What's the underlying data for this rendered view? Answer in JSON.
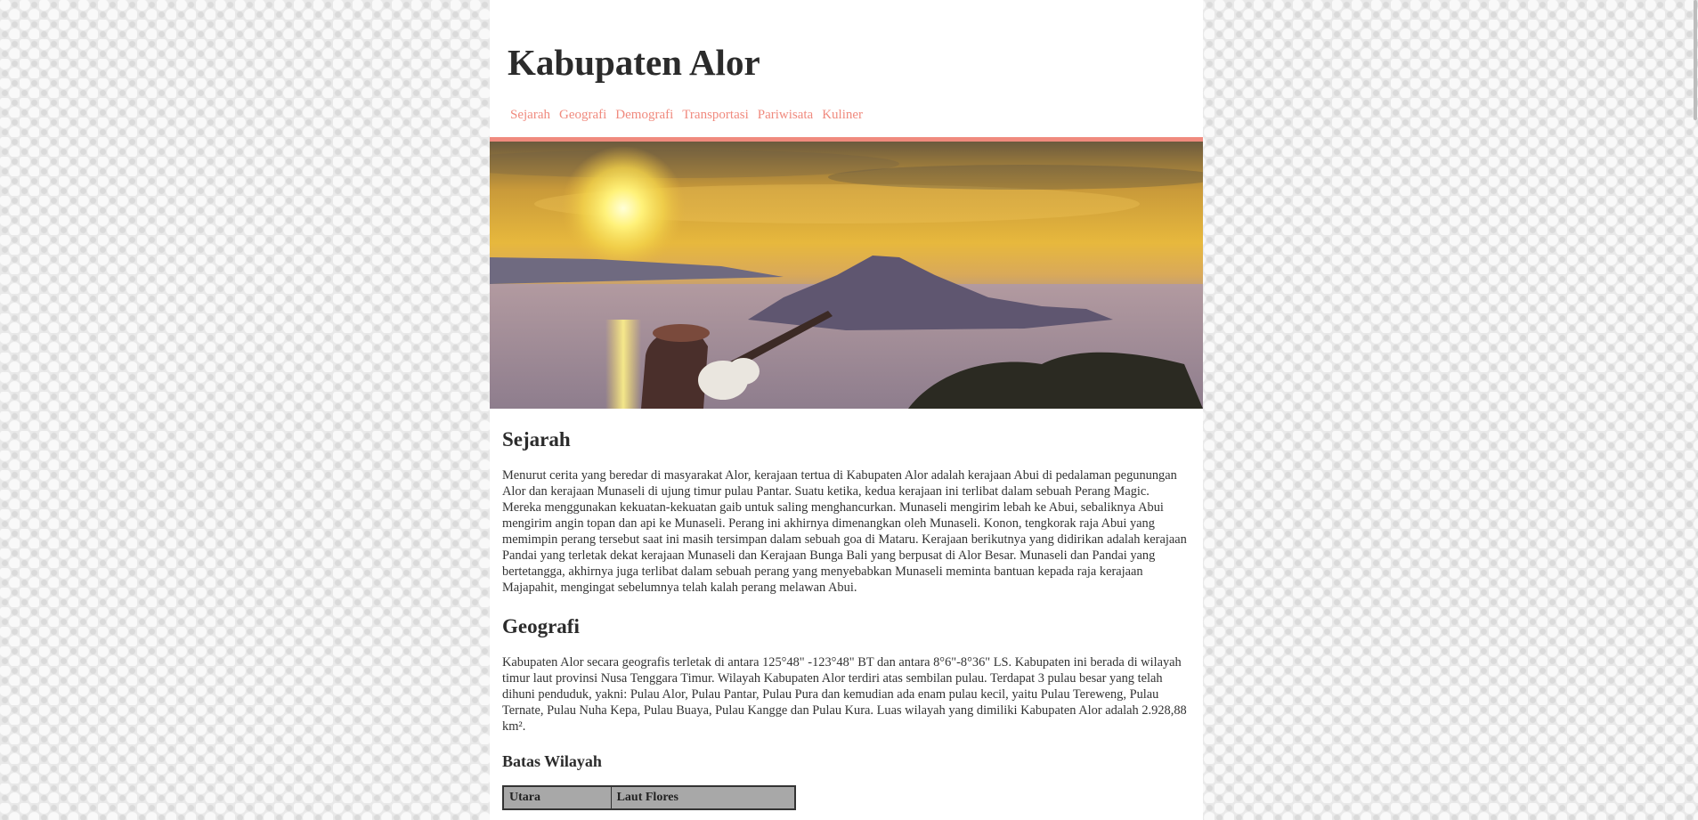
{
  "header": {
    "title": "Kabupaten Alor",
    "nav": [
      "Sejarah",
      "Geografi",
      "Demografi",
      "Transportasi",
      "Pariwisata",
      "Kuliner"
    ]
  },
  "colors": {
    "accent": "#f08a7e",
    "text": "#333333",
    "background": "#ffffff"
  },
  "sections": {
    "sejarah": {
      "heading": "Sejarah",
      "text": "Menurut cerita yang beredar di masyarakat Alor, kerajaan tertua di Kabupaten Alor adalah kerajaan Abui di pedalaman pegunungan Alor dan kerajaan Munaseli di ujung timur pulau Pantar. Suatu ketika, kedua kerajaan ini terlibat dalam sebuah Perang Magic. Mereka menggunakan kekuatan-kekuatan gaib untuk saling menghancurkan. Munaseli mengirim lebah ke Abui, sebaliknya Abui mengirim angin topan dan api ke Munaseli. Perang ini akhirnya dimenangkan oleh Munaseli. Konon, tengkorak raja Abui yang memimpin perang tersebut saat ini masih tersimpan dalam sebuah goa di Mataru. Kerajaan berikutnya yang didirikan adalah kerajaan Pandai yang terletak dekat kerajaan Munaseli dan Kerajaan Bunga Bali yang berpusat di Alor Besar. Munaseli dan Pandai yang bertetangga, akhirnya juga terlibat dalam sebuah perang yang menyebabkan Munaseli meminta bantuan kepada raja kerajaan Majapahit, mengingat sebelumnya telah kalah perang melawan Abui."
    },
    "geografi": {
      "heading": "Geografi",
      "text": "Kabupaten Alor secara geografis terletak di antara 125°48\" -123°48\" BT dan antara 8°6\"-8°36\" LS. Kabupaten ini berada di wilayah timur laut provinsi Nusa Tenggara Timur. Wilayah Kabupaten Alor terdiri atas sembilan pulau. Terdapat 3 pulau besar yang telah dihuni penduduk, yakni: Pulau Alor, Pulau Pantar, Pulau Pura dan kemudian ada enam pulau kecil, yaitu Pulau Tereweng, Pulau Ternate, Pulau Nuha Kepa, Pulau Buaya, Pulau Kangge dan Pulau Kura. Luas wilayah yang dimiliki Kabupaten Alor adalah 2.928,88 km²."
    },
    "batas": {
      "heading": "Batas Wilayah",
      "columns": [
        "Utara",
        "Laut Flores"
      ]
    }
  }
}
